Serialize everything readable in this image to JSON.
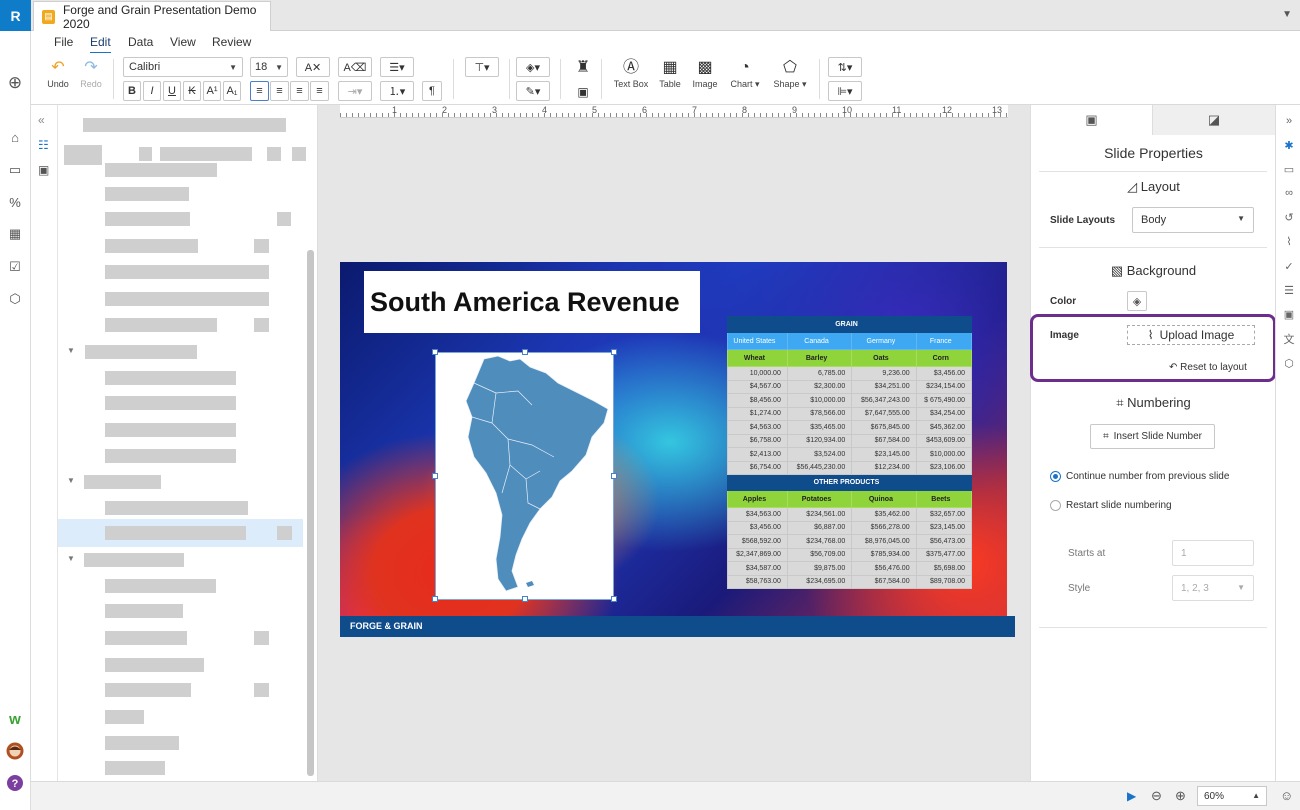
{
  "app": {
    "logo_letter": "R"
  },
  "tab": {
    "title": "Forge and Grain Presentation Demo 2020"
  },
  "menu": [
    "File",
    "Edit",
    "Data",
    "View",
    "Review"
  ],
  "toolbar": {
    "undo": "Undo",
    "redo": "Redo",
    "font_family": "Calibri",
    "font_size": "18",
    "text_box": "Text Box",
    "table": "Table",
    "image": "Image",
    "chart": "Chart",
    "shape": "Shape"
  },
  "ruler": [
    "1",
    "2",
    "3",
    "4",
    "5",
    "6",
    "7",
    "8",
    "9",
    "10",
    "11",
    "12",
    "13"
  ],
  "slide": {
    "title": "South America Revenue",
    "footer": "FORGE & GRAIN",
    "grain_header": "GRAIN",
    "countries": [
      "United States",
      "Canada",
      "Germany",
      "France"
    ],
    "grain_products": [
      "Wheat",
      "Barley",
      "Oats",
      "Corn"
    ],
    "grain_rows": [
      [
        "10,000.00",
        "6,785.00",
        "9,236.00",
        "$3,456.00"
      ],
      [
        "$4,567.00",
        "$2,300.00",
        "$34,251.00",
        "$234,154.00"
      ],
      [
        "$8,456.00",
        "$10,000.00",
        "$56,347,243.00",
        "$ 675,490.00"
      ],
      [
        "$1,274.00",
        "$78,566.00",
        "$7,647,555.00",
        "$34,254.00"
      ],
      [
        "$4,563.00",
        "$35,465.00",
        "$675,845.00",
        "$45,362.00"
      ],
      [
        "$6,758.00",
        "$120,934.00",
        "$67,584.00",
        "$453,609.00"
      ],
      [
        "$2,413.00",
        "$3,524.00",
        "$23,145.00",
        "$10,000.00"
      ],
      [
        "$6,754.00",
        "$56,445,230.00",
        "$12,234.00",
        "$23,106.00"
      ]
    ],
    "other_header": "OTHER PRODUCTS",
    "other_products": [
      "Apples",
      "Potatoes",
      "Quinoa",
      "Beets"
    ],
    "other_rows": [
      [
        "$34,563.00",
        "$234,561.00",
        "$35,462.00",
        "$32,657.00"
      ],
      [
        "$3,456.00",
        "$6,887.00",
        "$566,278.00",
        "$23,145.00"
      ],
      [
        "$568,592.00",
        "$234,768.00",
        "$8,976,045.00",
        "$56,473.00"
      ],
      [
        "$2,347,869.00",
        "$56,709.00",
        "$785,934.00",
        "$375,477.00"
      ],
      [
        "$34,587.00",
        "$9,875.00",
        "$56,476.00",
        "$5,698.00"
      ],
      [
        "$58,763.00",
        "$234,695.00",
        "$67,584.00",
        "$89,708.00"
      ]
    ]
  },
  "panel": {
    "title": "Slide Properties",
    "layout_section": "Layout",
    "slide_layouts_label": "Slide Layouts",
    "slide_layouts_value": "Body",
    "background_section": "Background",
    "color_label": "Color",
    "image_label": "Image",
    "upload_image": "Upload Image",
    "reset_to_layout": "Reset to layout",
    "numbering_section": "Numbering",
    "insert_slide_number": "Insert Slide Number",
    "continue_numbering": "Continue number from previous slide",
    "restart_numbering": "Restart slide numbering",
    "starts_at_label": "Starts at",
    "starts_at_value": "1",
    "style_label": "Style",
    "style_value": "1, 2, 3"
  },
  "status": {
    "zoom": "60%"
  },
  "colors": {
    "accent": "#0e7cc8",
    "highlight": "#6e2c8c",
    "table_header": "#0f4c8c",
    "country_row": "#3ea9f2",
    "product_row": "#8fd43a"
  }
}
